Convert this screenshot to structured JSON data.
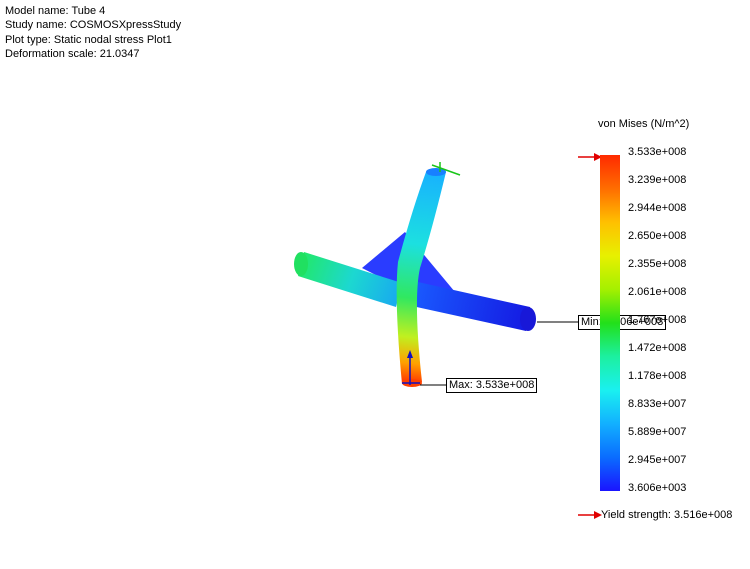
{
  "info": {
    "model_name": "Model name: Tube 4",
    "study_name": "Study name: COSMOSXpressStudy",
    "plot_type": "Plot type: Static nodal stress Plot1",
    "deformation_scale": "Deformation scale: 21.0347"
  },
  "legend": {
    "title": "von Mises (N/m^2)",
    "ticks": [
      "3.533e+008",
      "3.239e+008",
      "2.944e+008",
      "2.650e+008",
      "2.355e+008",
      "2.061e+008",
      "1.767e+008",
      "1.472e+008",
      "1.178e+008",
      "8.833e+007",
      "5.889e+007",
      "2.945e+007",
      "3.606e+003"
    ],
    "yield_strength": "Yield strength: 3.516e+008",
    "colors": {
      "max": "#ff2a00",
      "min": "#1a14ff",
      "marker": "#e00000"
    }
  },
  "callouts": {
    "max": "Max: 3.533e+008",
    "min": "Min: 3.606e+003"
  }
}
